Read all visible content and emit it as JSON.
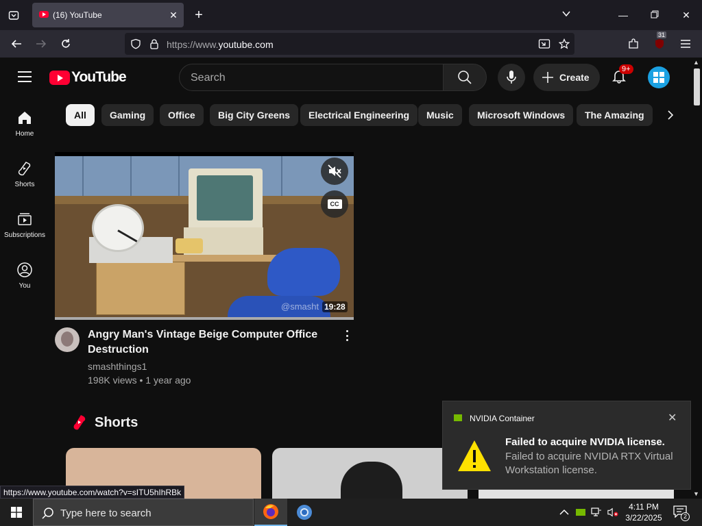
{
  "browser": {
    "tab_title": "(16) YouTube",
    "url_prefix": "https://www.",
    "url_domain": "youtube.com",
    "url_suffix": "",
    "extension_badge": "31"
  },
  "header": {
    "logo_text": "YouTube",
    "search_placeholder": "Search",
    "create_label": "Create",
    "notifications_badge": "9+"
  },
  "sidebar": {
    "items": [
      {
        "label": "Home",
        "icon": "home-icon"
      },
      {
        "label": "Shorts",
        "icon": "shorts-icon"
      },
      {
        "label": "Subscriptions",
        "icon": "subscriptions-icon"
      },
      {
        "label": "You",
        "icon": "you-icon"
      }
    ]
  },
  "chips": [
    "All",
    "Gaming",
    "Office",
    "Big City Greens",
    "Electrical Engineering",
    "Music",
    "Microsoft Windows",
    "The Amazing"
  ],
  "video": {
    "title": "Angry Man's Vintage Beige Computer Office Destruction",
    "channel": "smashthings1",
    "meta": "198K views • 1 year ago",
    "duration": "19:28",
    "watermark": "@smasht",
    "progress": 1.0
  },
  "shorts": {
    "label": "Shorts"
  },
  "status_link": "https://www.youtube.com/watch?v=sITU5hIhRBk",
  "toast": {
    "app": "NVIDIA Container",
    "title": "Failed to acquire NVIDIA license.",
    "body": "Failed to acquire NVIDIA RTX Virtual Workstation license."
  },
  "taskbar": {
    "search_placeholder": "Type here to search",
    "time": "4:11 PM",
    "date": "3/22/2025",
    "notification_count": "2"
  }
}
